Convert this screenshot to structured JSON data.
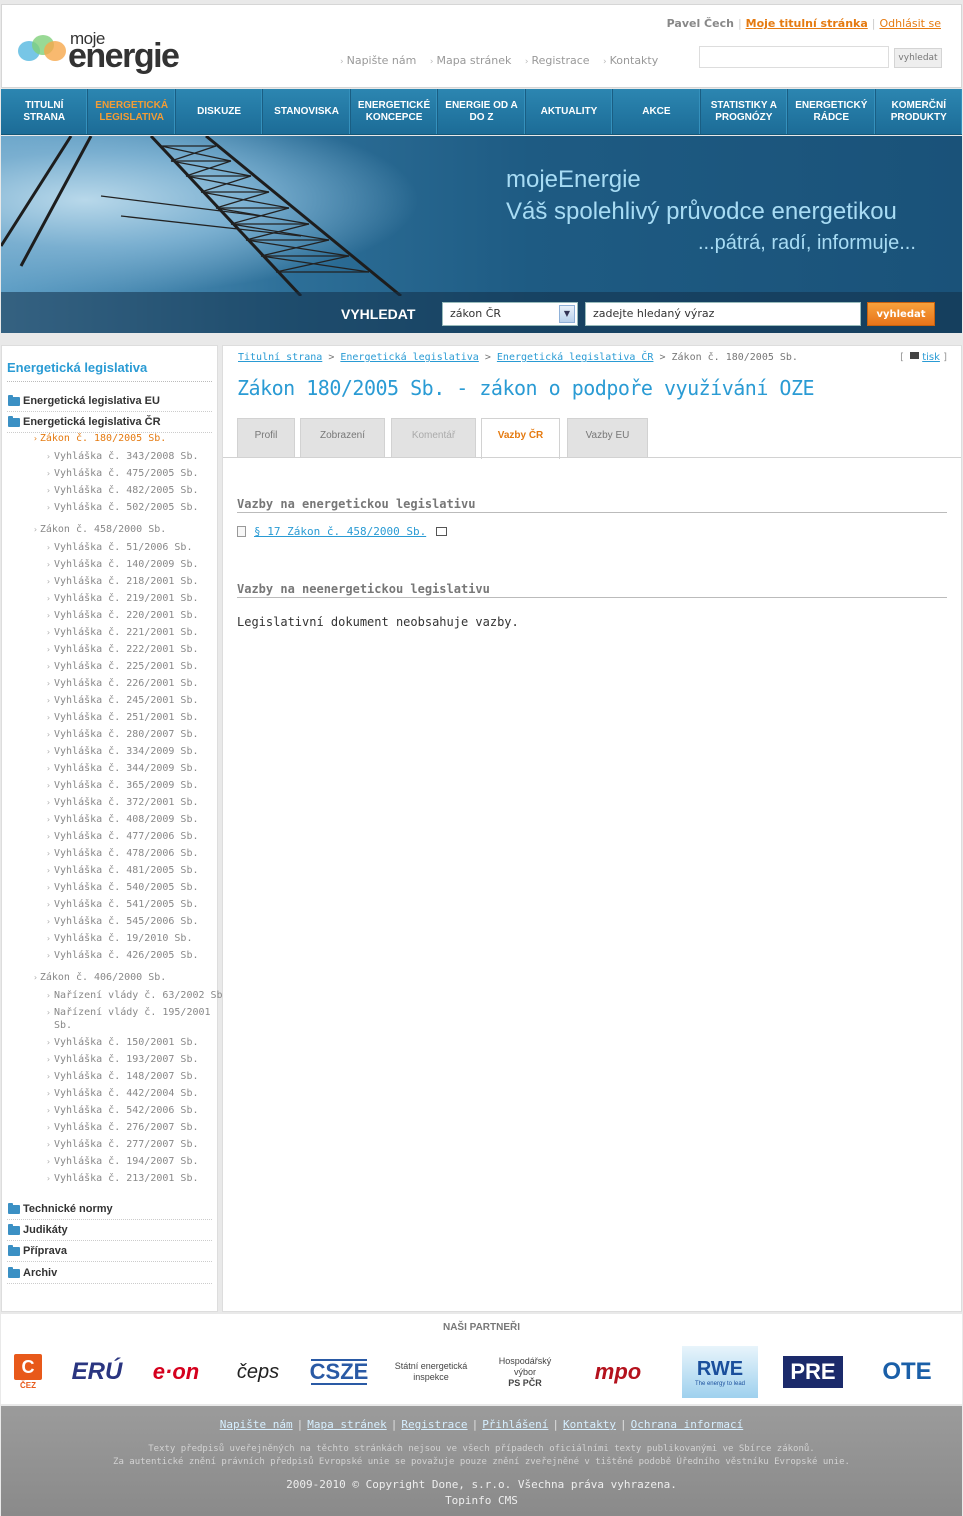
{
  "header": {
    "logo_small": "moje",
    "logo_big": "energie",
    "user_name": "Pavel Čech",
    "my_homepage": "Moje titulní stránka",
    "logout": "Odhlásit se",
    "top_links": [
      "Napište nám",
      "Mapa stránek",
      "Registrace",
      "Kontakty"
    ],
    "search_button": "vyhledat"
  },
  "nav": {
    "items": [
      {
        "label": "Titulní strana"
      },
      {
        "label": "Energetická legislativa",
        "active": true
      },
      {
        "label": "Diskuze"
      },
      {
        "label": "Stanoviska"
      },
      {
        "label": "Energetické koncepce"
      },
      {
        "label": "Energie od A do Z"
      },
      {
        "label": "Aktuality"
      },
      {
        "label": "Akce"
      },
      {
        "label": "Statistiky a prognózy"
      },
      {
        "label": "Energetický rádce"
      },
      {
        "label": "Komerční produkty"
      }
    ]
  },
  "banner": {
    "line1": "mojeEnergie",
    "line2": "Váš spolehlivý průvodce energetikou",
    "line3": "...pátrá, radí, informuje...",
    "search_label": "VYHLEDAT",
    "select_value": "zákon ČR",
    "input_placeholder": "zadejte hledaný výraz",
    "search_button": "vyhledat"
  },
  "sidebar": {
    "title": "Energetická legislativa",
    "categories_top": [
      "Energetická legislativa EU",
      "Energetická legislativa ČR"
    ],
    "laws": [
      {
        "label": "Zákon č. 180/2005 Sb.",
        "active": true,
        "children": [
          "Vyhláška č. 343/2008 Sb.",
          "Vyhláška č. 475/2005 Sb.",
          "Vyhláška č. 482/2005 Sb.",
          "Vyhláška č. 502/2005 Sb."
        ]
      },
      {
        "label": "Zákon č. 458/2000 Sb.",
        "children": [
          "Vyhláška č. 51/2006 Sb.",
          "Vyhláška č. 140/2009 Sb.",
          "Vyhláška č. 218/2001 Sb.",
          "Vyhláška č. 219/2001 Sb.",
          "Vyhláška č. 220/2001 Sb.",
          "Vyhláška č. 221/2001 Sb.",
          "Vyhláška č. 222/2001 Sb.",
          "Vyhláška č. 225/2001 Sb.",
          "Vyhláška č. 226/2001 Sb.",
          "Vyhláška č. 245/2001 Sb.",
          "Vyhláška č. 251/2001 Sb.",
          "Vyhláška č. 280/2007 Sb.",
          "Vyhláška č. 334/2009 Sb.",
          "Vyhláška č. 344/2009 Sb.",
          "Vyhláška č. 365/2009 Sb.",
          "Vyhláška č. 372/2001 Sb.",
          "Vyhláška č. 408/2009 Sb.",
          "Vyhláška č. 477/2006 Sb.",
          "Vyhláška č. 478/2006 Sb.",
          "Vyhláška č. 481/2005 Sb.",
          "Vyhláška č. 540/2005 Sb.",
          "Vyhláška č. 541/2005 Sb.",
          "Vyhláška č. 545/2006 Sb.",
          "Vyhláška č. 19/2010 Sb.",
          "Vyhláška č. 426/2005 Sb."
        ]
      },
      {
        "label": "Zákon č. 406/2000 Sb.",
        "children": [
          "Nařízení vlády č. 63/2002 Sb.",
          "Nařízení vlády č. 195/2001 Sb.",
          "Vyhláška č. 150/2001 Sb.",
          "Vyhláška č. 193/2007 Sb.",
          "Vyhláška č. 148/2007 Sb.",
          "Vyhláška č. 442/2004 Sb.",
          "Vyhláška č. 542/2006 Sb.",
          "Vyhláška č. 276/2007 Sb.",
          "Vyhláška č. 277/2007 Sb.",
          "Vyhláška č. 194/2007 Sb.",
          "Vyhláška č. 213/2001 Sb."
        ]
      }
    ],
    "categories_bottom": [
      "Technické normy",
      "Judikáty",
      "Příprava",
      "Archiv"
    ]
  },
  "main": {
    "breadcrumb": [
      "Titulní strana",
      "Energetická legislativa",
      "Energetická legislativa ČR",
      "Zákon č. 180/2005 Sb."
    ],
    "print_label": "tisk",
    "title": "Zákon 180/2005 Sb. - zákon o podpoře využívání OZE",
    "tabs": [
      {
        "label": "Profil"
      },
      {
        "label": "Zobrazení"
      },
      {
        "label": "Komentář",
        "disabled": true
      },
      {
        "label": "Vazby ČR",
        "active": true
      },
      {
        "label": "Vazby EU"
      }
    ],
    "section1_title": "Vazby na energetickou legislativu",
    "section1_link": "§ 17 Zákon č. 458/2000 Sb.",
    "section2_title": "Vazby na neenergetickou legislativu",
    "section2_text": "Legislativní dokument neobsahuje vazby."
  },
  "partners": {
    "title": "NAŠI PARTNEŘI",
    "cez": "ČEZ",
    "eru": "ERÚ",
    "eon": "e·on",
    "ceps": "čeps",
    "csze": "CSZE",
    "sei": "Státní energetická inspekce",
    "hv_l1": "Hospodářský",
    "hv_l2": "výbor",
    "hv_l3": "PS PČR",
    "mpo": "mpo",
    "rwe": "RWE",
    "rwe_sub": "The energy to lead",
    "pre": "PRE",
    "ote": "OTE"
  },
  "footer": {
    "links": [
      "Napište nám",
      "Mapa stránek",
      "Registrace",
      "Přihlášení",
      "Kontakty",
      "Ochrana informací"
    ],
    "note1": "Texty předpisů uveřejněných na těchto stránkách nejsou ve všech případech oficiálními texty publikovanými ve Sbírce zákonů.",
    "note2": "Za autentické znění právních předpisů Evropské unie se považuje pouze znění zveřejněné v tištěné podobě Úředního věstníku Evropské unie.",
    "copyright": "2009-2010 © Copyright Done, s.r.o. Všechna práva vyhrazena.",
    "cms": "Topinfo CMS"
  }
}
